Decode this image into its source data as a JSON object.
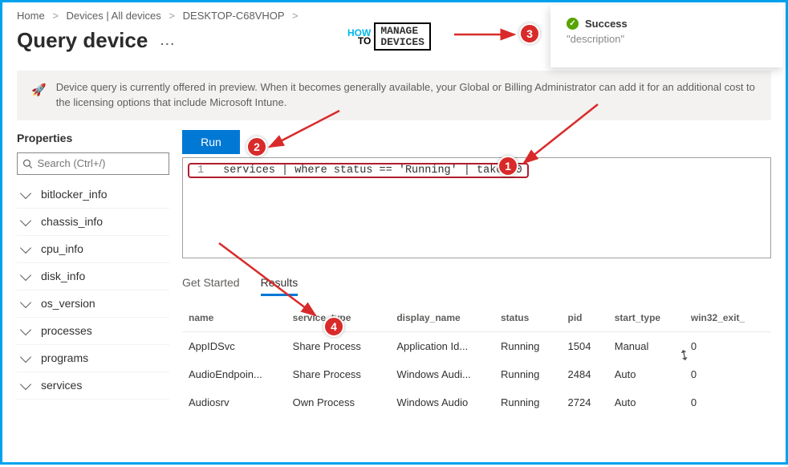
{
  "breadcrumb": [
    "Home",
    "Devices | All devices",
    "DESKTOP-C68VHOP"
  ],
  "page_title": "Query device",
  "logo": {
    "how": "HOW",
    "to": "TO",
    "line1": "MANAGE",
    "line2": "DEVICES"
  },
  "toast": {
    "title": "Success",
    "desc": "\"description\""
  },
  "info_bar": "Device query is currently offered in preview. When it becomes generally available, your Global or Billing Administrator can add it for an additional cost to the licensing options that include Microsoft Intune.",
  "sidebar": {
    "title": "Properties",
    "search_placeholder": "Search (Ctrl+/)",
    "items": [
      "bitlocker_info",
      "chassis_info",
      "cpu_info",
      "disk_info",
      "os_version",
      "processes",
      "programs",
      "services"
    ]
  },
  "actions": {
    "run": "Run"
  },
  "editor": {
    "line_number": "1",
    "code": "services | where status == 'Running' | take 10"
  },
  "tabs": {
    "get_started": "Get Started",
    "results": "Results"
  },
  "table": {
    "columns": [
      "name",
      "service_type",
      "display_name",
      "status",
      "pid",
      "start_type",
      "win32_exit_"
    ],
    "rows": [
      {
        "name": "AppIDSvc",
        "service_type": "Share Process",
        "display_name": "Application Id...",
        "status": "Running",
        "pid": "1504",
        "start_type": "Manual",
        "win32_exit_": "0"
      },
      {
        "name": "AudioEndpoin...",
        "service_type": "Share Process",
        "display_name": "Windows Audi...",
        "status": "Running",
        "pid": "2484",
        "start_type": "Auto",
        "win32_exit_": "0"
      },
      {
        "name": "Audiosrv",
        "service_type": "Own Process",
        "display_name": "Windows Audio",
        "status": "Running",
        "pid": "2724",
        "start_type": "Auto",
        "win32_exit_": "0"
      }
    ]
  },
  "annotations": {
    "1": "1",
    "2": "2",
    "3": "3",
    "4": "4"
  }
}
